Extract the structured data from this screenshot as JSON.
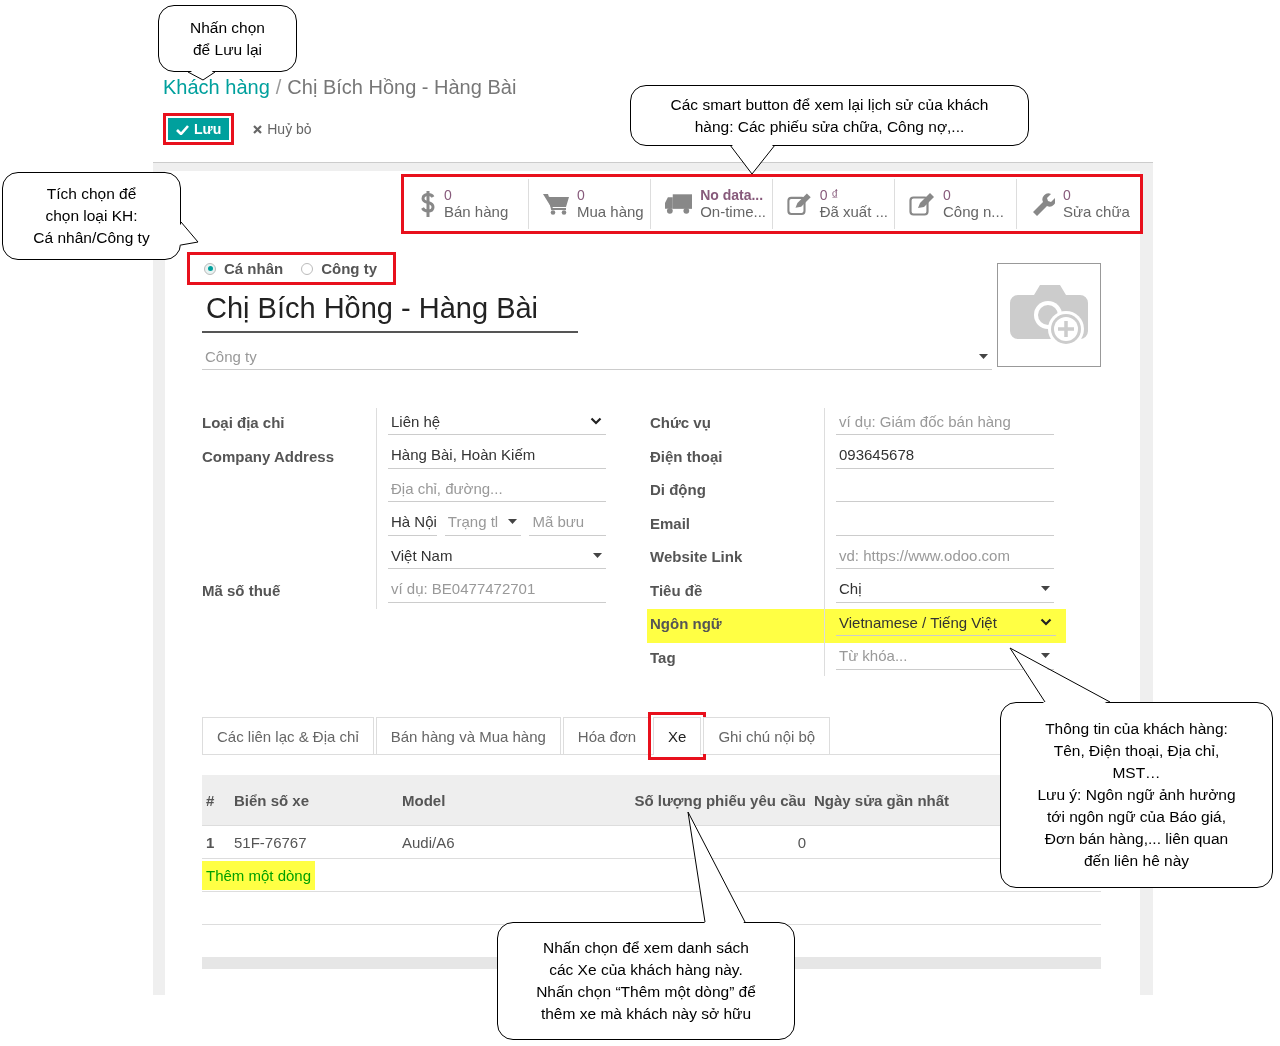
{
  "breadcrumb": {
    "separator": "/",
    "items": [
      {
        "label": "Khách hàng",
        "kind": "link"
      },
      {
        "label": "Chị Bích Hồng - Hàng Bài",
        "kind": "current"
      }
    ]
  },
  "actions": [
    {
      "label": "Lưu",
      "kind": "primary",
      "highlighted": true
    },
    {
      "label": "Huỷ bỏ",
      "kind": "secondary",
      "highlighted": false
    }
  ],
  "button_box": {
    "highlighted": true,
    "buttons": [
      {
        "kind": "sales",
        "value": "0",
        "label": "Bán hàng"
      },
      {
        "kind": "purchase",
        "value": "0",
        "label": "Mua hàng"
      },
      {
        "kind": "delivery",
        "value": "No data...",
        "label": "On-time..."
      },
      {
        "kind": "invoiced",
        "value": "0 ₫",
        "label": "Đã xuất ..."
      },
      {
        "kind": "debt",
        "value": "0",
        "label": "Công n..."
      },
      {
        "kind": "repair",
        "value": "0",
        "label": "Sửa chữa"
      }
    ]
  },
  "company_type": {
    "highlighted": true,
    "options": [
      {
        "label": "Cá nhân",
        "selected": true
      },
      {
        "label": "Công ty",
        "selected": false
      }
    ]
  },
  "name": "Chị Bích Hồng - Hàng Bài",
  "company_field": {
    "placeholder": "Công ty"
  },
  "left_fields": [
    {
      "label": "Loại địa chỉ",
      "kind": "select",
      "value": "Liên hệ"
    }
  ],
  "address": {
    "label": "Company Address",
    "street": {
      "value": "Hàng Bài, Hoàn Kiếm"
    },
    "street2": {
      "placeholder": "Địa chỉ, đường..."
    },
    "city": {
      "value": "Hà Nội"
    },
    "state": {
      "placeholder": "Trạng tl"
    },
    "zip": {
      "placeholder": "Mã bưu"
    },
    "country": {
      "value": "Việt Nam"
    }
  },
  "tax_field": {
    "label": "Mã số thuế",
    "placeholder": "ví dụ: BE0477472701"
  },
  "right_fields": [
    {
      "label": "Chức vụ",
      "kind": "text",
      "placeholder": "ví dụ: Giám đốc bán hàng",
      "marked": false
    },
    {
      "label": "Điện thoại",
      "kind": "text",
      "value": "093645678",
      "marked": false
    },
    {
      "label": "Di động",
      "kind": "text",
      "marked": false
    },
    {
      "label": "Email",
      "kind": "text",
      "marked": false
    },
    {
      "label": "Website Link",
      "kind": "text",
      "placeholder": "vd: https://www.odoo.com",
      "marked": false
    },
    {
      "label": "Tiêu đề",
      "kind": "dropdown",
      "value": "Chị",
      "marked": false
    },
    {
      "label": "Ngôn ngữ",
      "kind": "select",
      "value": "Vietnamese / Tiếng Việt",
      "marked": true
    },
    {
      "label": "Tag",
      "kind": "dropdown",
      "placeholder": "Từ khóa...",
      "marked": false
    }
  ],
  "tabs": [
    {
      "label": "Các liên lạc & Địa chỉ",
      "selected": false,
      "highlighted": false
    },
    {
      "label": "Bán hàng và Mua hàng",
      "selected": false,
      "highlighted": false
    },
    {
      "label": "Hóa đơn",
      "selected": false,
      "highlighted": false
    },
    {
      "label": "Xe",
      "selected": true,
      "highlighted": true
    },
    {
      "label": "Ghi chú nội bộ",
      "selected": false,
      "highlighted": false
    }
  ],
  "table": {
    "columns": [
      "#",
      "Biển số xe",
      "Model",
      "Số lượng phiếu yêu cầu",
      "Ngày sửa gần nhất"
    ],
    "rows": [
      {
        "index": "1",
        "plate": "51F-76767",
        "model": "Audi/A6",
        "count": "0"
      }
    ],
    "add_line": {
      "label": "Thêm một dòng",
      "marked": true
    }
  },
  "callouts": [
    {
      "text": "Nhấn chọn\nđể Lưu lại"
    },
    {
      "text": "Các smart button để xem lại lịch sử của khách\nhàng: Các phiếu sửa chữa, Công nợ,..."
    },
    {
      "text": "Tích chọn để\nchọn loại KH:\nCá nhân/Công  ty"
    },
    {
      "text": "Thông tin của khách hàng:\nTên, Điện thoại, Địa chỉ,\nMST…\nLưu ý: Ngôn ngữ ảnh hưởng\ntới ngôn ngữ của Báo giá,\nĐơn bán hàng,... liên quan\nđến liên hê này"
    },
    {
      "text": "Nhấn chọn để xem danh sách\ncác Xe của khách hàng này.\nNhấn chọn “Thêm một dòng” để\nthêm xe mà khách này sở hữu"
    }
  ]
}
